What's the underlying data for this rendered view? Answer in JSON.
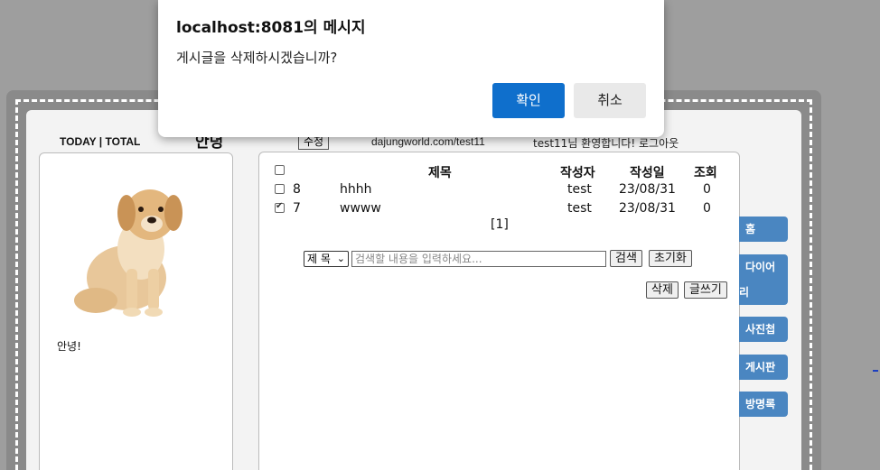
{
  "dialog": {
    "title": "localhost:8081의 메시지",
    "message": "게시글을 삭제하시겠습니까?",
    "ok_label": "확인",
    "cancel_label": "취소"
  },
  "header": {
    "today_total": "TODAY | TOTAL",
    "hello_title": "안녕",
    "edit_label": "수정",
    "url": "dajungworld.com/test11",
    "welcome": "test11님 환영합니다! 로그아웃"
  },
  "profile": {
    "text": "안녕!"
  },
  "board": {
    "columns": [
      "제목",
      "작성자",
      "작성일",
      "조회"
    ],
    "rows": [
      {
        "num": "8",
        "title": "hhhh",
        "writer": "test",
        "date": "23/08/31",
        "views": "0",
        "checked": false
      },
      {
        "num": "7",
        "title": "wwww",
        "writer": "test",
        "date": "23/08/31",
        "views": "0",
        "checked": true
      }
    ],
    "pager": "[1]",
    "search_select": "제 목",
    "search_placeholder": "검색할 내용을 입력하세요...",
    "search_label": "검색",
    "reset_label": "초기화",
    "delete_label": "삭제",
    "write_label": "글쓰기"
  },
  "nav": {
    "items": [
      "홈",
      "다이어",
      "리",
      "사진첩",
      "게시판",
      "방명록"
    ]
  },
  "colors": {
    "nav": "#4a86c1",
    "ok_button": "#0f6fcc"
  }
}
